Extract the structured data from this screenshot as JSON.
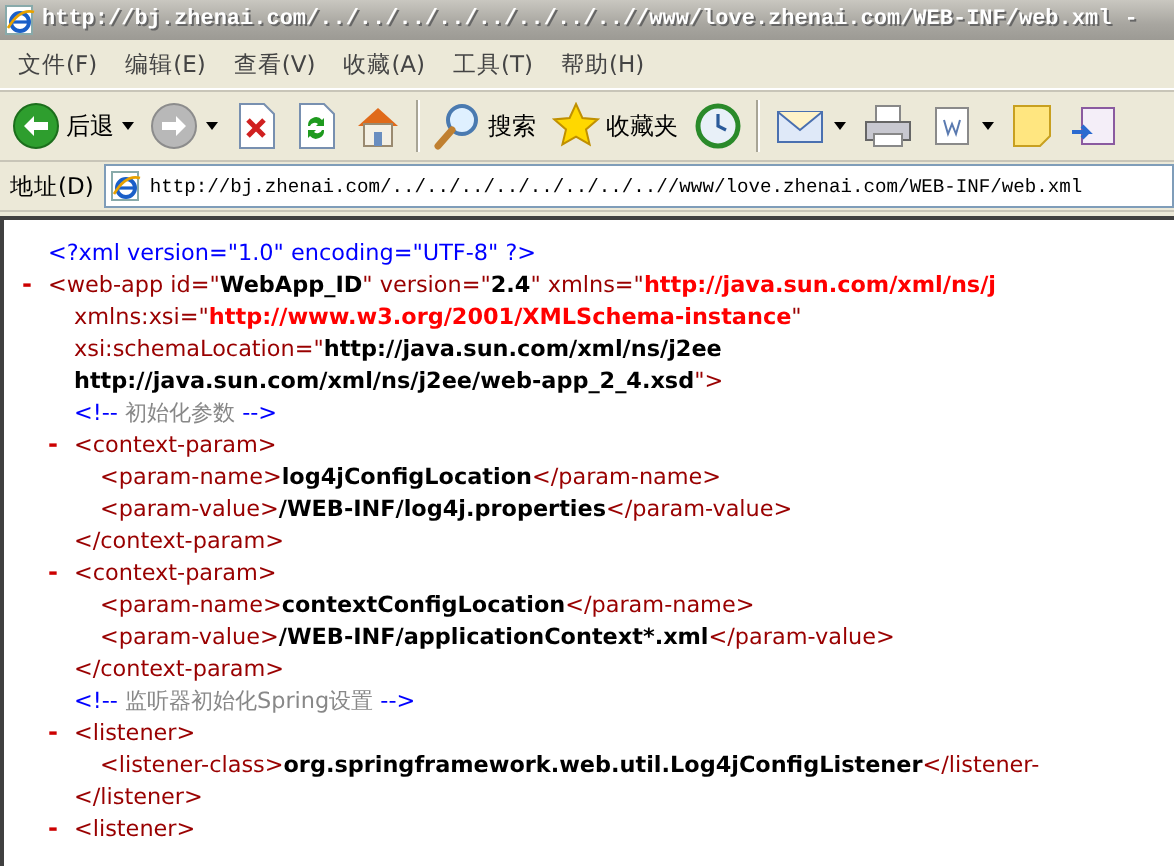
{
  "window": {
    "title": "http://bj.zhenai.com/../../../../../../../..//www/love.zhenai.com/WEB-INF/web.xml -"
  },
  "menu": [
    "文件(F)",
    "编辑(E)",
    "查看(V)",
    "收藏(A)",
    "工具(T)",
    "帮助(H)"
  ],
  "toolbar": [
    {
      "kind": "back",
      "label": "后退",
      "dropdown": true
    },
    {
      "kind": "forward",
      "dropdown": true
    },
    {
      "kind": "stop",
      "dropdown": false
    },
    {
      "kind": "refresh",
      "dropdown": false
    },
    {
      "kind": "home",
      "dropdown": false
    },
    {
      "kind": "separator"
    },
    {
      "kind": "search",
      "label": "搜索",
      "dropdown": false
    },
    {
      "kind": "favorites",
      "label": "收藏夹",
      "dropdown": false
    },
    {
      "kind": "history",
      "dropdown": false
    },
    {
      "kind": "separator"
    },
    {
      "kind": "mail",
      "dropdown": true
    },
    {
      "kind": "print",
      "dropdown": false
    },
    {
      "kind": "edit",
      "dropdown": true
    },
    {
      "kind": "note",
      "dropdown": false
    },
    {
      "kind": "messenger",
      "dropdown": false
    }
  ],
  "address": {
    "label": "地址(D)",
    "value": "http://bj.zhenai.com/../../../../../../../..//www/love.zhenai.com/WEB-INF/web.xml"
  },
  "document": [
    {
      "kind": "pi",
      "lines": [
        [
          {
            "kind": "punct",
            "text": "<?xml version=\"1.0\" encoding=\"UTF-8\" ?>"
          }
        ]
      ]
    },
    {
      "kind": "element",
      "toggle": "-",
      "expanded": true,
      "open": [
        [
          {
            "kind": "tag",
            "text": "<web-app id=\""
          },
          {
            "kind": "val",
            "text": "WebApp_ID"
          },
          {
            "kind": "tag",
            "text": "\" version=\""
          },
          {
            "kind": "val",
            "text": "2.4"
          },
          {
            "kind": "tag",
            "text": "\" xmlns=\""
          },
          {
            "kind": "ns",
            "text": "http://java.sun.com/xml/ns/j"
          }
        ],
        [
          {
            "kind": "tag",
            "text": "xmlns:xsi=\""
          },
          {
            "kind": "ns",
            "text": "http://www.w3.org/2001/XMLSchema-instance"
          },
          {
            "kind": "tag",
            "text": "\""
          }
        ],
        [
          {
            "kind": "tag",
            "text": "xsi:schemaLocation=\""
          },
          {
            "kind": "val",
            "text": "http://java.sun.com/xml/ns/j2ee"
          }
        ],
        [
          {
            "kind": "val",
            "text": "http://java.sun.com/xml/ns/j2ee/web-app_2_4.xsd"
          },
          {
            "kind": "tag",
            "text": "\">"
          }
        ]
      ],
      "children": [
        {
          "kind": "comment",
          "lines": [
            [
              {
                "kind": "punct",
                "text": "<!--"
              },
              {
                "kind": "cm",
                "text": " 初始化参数 "
              },
              {
                "kind": "punct",
                "text": "-->"
              }
            ]
          ]
        },
        {
          "kind": "element",
          "toggle": "-",
          "expanded": true,
          "open": [
            [
              {
                "kind": "tag",
                "text": "<context-param>"
              }
            ]
          ],
          "children": [
            {
              "kind": "leaf",
              "lines": [
                [
                  {
                    "kind": "tag",
                    "text": "<param-name>"
                  },
                  {
                    "kind": "val",
                    "text": "log4jConfigLocation"
                  },
                  {
                    "kind": "tag",
                    "text": "</param-name>"
                  }
                ]
              ]
            },
            {
              "kind": "leaf",
              "lines": [
                [
                  {
                    "kind": "tag",
                    "text": "<param-value>"
                  },
                  {
                    "kind": "val",
                    "text": "/WEB-INF/log4j.properties"
                  },
                  {
                    "kind": "tag",
                    "text": "</param-value>"
                  }
                ]
              ]
            }
          ],
          "close": [
            [
              {
                "kind": "tag",
                "text": "</context-param>"
              }
            ]
          ]
        },
        {
          "kind": "element",
          "toggle": "-",
          "expanded": true,
          "open": [
            [
              {
                "kind": "tag",
                "text": "<context-param>"
              }
            ]
          ],
          "children": [
            {
              "kind": "leaf",
              "lines": [
                [
                  {
                    "kind": "tag",
                    "text": "<param-name>"
                  },
                  {
                    "kind": "val",
                    "text": "contextConfigLocation"
                  },
                  {
                    "kind": "tag",
                    "text": "</param-name>"
                  }
                ]
              ]
            },
            {
              "kind": "leaf",
              "lines": [
                [
                  {
                    "kind": "tag",
                    "text": "<param-value>"
                  },
                  {
                    "kind": "val",
                    "text": "/WEB-INF/applicationContext*.xml"
                  },
                  {
                    "kind": "tag",
                    "text": "</param-value>"
                  }
                ]
              ]
            }
          ],
          "close": [
            [
              {
                "kind": "tag",
                "text": "</context-param>"
              }
            ]
          ]
        },
        {
          "kind": "comment",
          "lines": [
            [
              {
                "kind": "punct",
                "text": "<!--"
              },
              {
                "kind": "cm",
                "text": " 监听器初始化Spring设置 "
              },
              {
                "kind": "punct",
                "text": "-->"
              }
            ]
          ]
        },
        {
          "kind": "element",
          "toggle": "-",
          "expanded": true,
          "open": [
            [
              {
                "kind": "tag",
                "text": "<listener>"
              }
            ]
          ],
          "children": [
            {
              "kind": "leaf",
              "lines": [
                [
                  {
                    "kind": "tag",
                    "text": "<listener-class>"
                  },
                  {
                    "kind": "val",
                    "text": "org.springframework.web.util.Log4jConfigListener"
                  },
                  {
                    "kind": "tag",
                    "text": "</listener-"
                  }
                ]
              ]
            }
          ],
          "close": [
            [
              {
                "kind": "tag",
                "text": "</listener>"
              }
            ]
          ]
        },
        {
          "kind": "element",
          "toggle": "-",
          "expanded": true,
          "open": [
            [
              {
                "kind": "tag",
                "text": "<listener>"
              }
            ]
          ]
        }
      ]
    }
  ]
}
